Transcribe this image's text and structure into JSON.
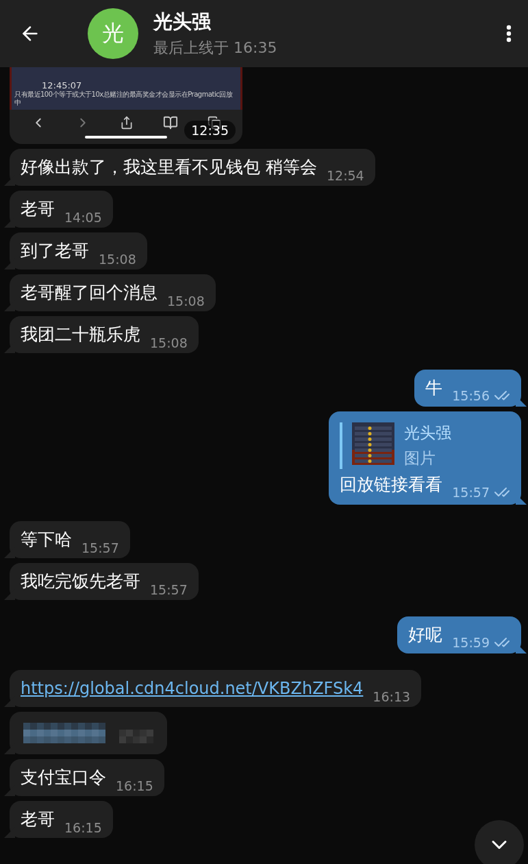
{
  "header": {
    "avatar_letter": "光",
    "name": "光头强",
    "status": "最后上线于 16:35"
  },
  "messages": [
    {
      "kind": "screenshot",
      "outgoing": false,
      "time": "12:35",
      "shot": {
        "clock": "12:45:07",
        "note": "只有最近100个等于或大于10x总赌注的最高奖金才会显示在Pragmatic回放中"
      }
    },
    {
      "kind": "text",
      "outgoing": false,
      "text": "好像出款了，我这里看不见钱包 稍等会",
      "time": "12:54"
    },
    {
      "kind": "text",
      "outgoing": false,
      "text": "老哥",
      "time": "14:05"
    },
    {
      "kind": "text",
      "outgoing": false,
      "text": "到了老哥",
      "time": "15:08"
    },
    {
      "kind": "text",
      "outgoing": false,
      "text": "老哥醒了回个消息",
      "time": "15:08"
    },
    {
      "kind": "text",
      "outgoing": false,
      "text": "我团二十瓶乐虎",
      "time": "15:08"
    },
    {
      "kind": "text",
      "outgoing": true,
      "text": "牛",
      "time": "15:56",
      "read": true
    },
    {
      "kind": "reply",
      "outgoing": true,
      "reply_to": {
        "name": "光头强",
        "preview": "图片"
      },
      "text": "回放链接看看",
      "time": "15:57",
      "read": true
    },
    {
      "kind": "text",
      "outgoing": false,
      "text": "等下哈",
      "time": "15:57"
    },
    {
      "kind": "text",
      "outgoing": false,
      "text": "我吃完饭先老哥",
      "time": "15:57"
    },
    {
      "kind": "text",
      "outgoing": true,
      "text": "好呢",
      "time": "15:59",
      "read": true
    },
    {
      "kind": "link",
      "outgoing": false,
      "text": "https://global.cdn4cloud.net/VKBZhZFSk4",
      "time": "16:13"
    },
    {
      "kind": "pixelated",
      "outgoing": false
    },
    {
      "kind": "text",
      "outgoing": false,
      "text": "支付宝口令",
      "time": "16:15"
    },
    {
      "kind": "text",
      "outgoing": false,
      "text": "老哥",
      "time": "16:15"
    }
  ]
}
